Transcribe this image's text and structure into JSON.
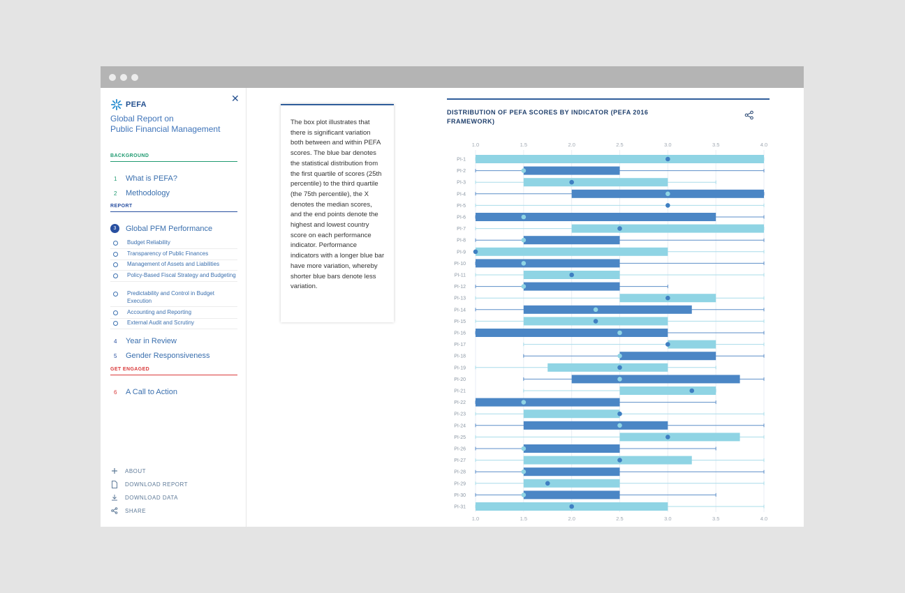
{
  "sidebar": {
    "logo_text": "PEFA",
    "title_line1": "Global Report on",
    "title_line2": "Public Financial Management",
    "background_label": "BACKGROUND",
    "report_label": "REPORT",
    "engaged_label": "GET ENGAGED",
    "nav": [
      {
        "num": "1",
        "label": "What is PEFA?"
      },
      {
        "num": "2",
        "label": "Methodology"
      },
      {
        "num": "3",
        "label": "Global PFM Performance"
      },
      {
        "num": "4",
        "label": "Year in Review"
      },
      {
        "num": "5",
        "label": "Gender Responsiveness"
      },
      {
        "num": "6",
        "label": "A Call to Action"
      }
    ],
    "subitems": [
      "Budget Reliability",
      "Transparency of Public Finances",
      "Management of Assets and Liabilities",
      "Policy-Based Fiscal Strategy and Budgeting",
      "Predictability and Control in Budget Execution",
      "Accounting and Reporting",
      "External Audit and Scrutiny"
    ],
    "footer": [
      "ABOUT",
      "DOWNLOAD REPORT",
      "DOWNLOAD DATA",
      "SHARE"
    ]
  },
  "text_card": "The box plot illustrates that there is significant variation both between and within PEFA scores. The blue bar denotes the statistical distribution from the first quartile of scores (25th percentile) to the third quartile (the 75th percentile), the X denotes the median scores, and the end points denote the highest and lowest country score on each performance indicator. Performance indicators with a longer blue bar have more variation, whereby shorter blue bars denote less variation.",
  "colors": {
    "dark_box": "#4b86c5",
    "light_box": "#8fd4e4",
    "accent": "#2f5d9a"
  },
  "chart_data": {
    "type": "box",
    "title": "DISTRIBUTION OF PEFA SCORES BY INDICATOR (PEFA 2016 FRAMEWORK)",
    "xlim": [
      1.0,
      4.0
    ],
    "xticks": [
      "1.0",
      "1.5",
      "2.0",
      "2.5",
      "3.0",
      "3.5",
      "4.0"
    ],
    "grid": true,
    "indicators": [
      {
        "label": "PI-1",
        "min": 1.0,
        "q1": 1.0,
        "median": 3.0,
        "q3": 4.0,
        "max": 4.0,
        "tone": "light"
      },
      {
        "label": "PI-2",
        "min": 1.0,
        "q1": 1.5,
        "median": 1.5,
        "q3": 2.5,
        "max": 4.0,
        "tone": "dark"
      },
      {
        "label": "PI-3",
        "min": 1.0,
        "q1": 1.5,
        "median": 2.0,
        "q3": 3.0,
        "max": 3.5,
        "tone": "light"
      },
      {
        "label": "PI-4",
        "min": 1.0,
        "q1": 2.0,
        "median": 3.0,
        "q3": 4.0,
        "max": 4.0,
        "tone": "dark"
      },
      {
        "label": "PI-5",
        "min": 1.0,
        "q1": 3.0,
        "median": 3.0,
        "q3": 3.0,
        "max": 4.0,
        "tone": "light"
      },
      {
        "label": "PI-6",
        "min": 1.0,
        "q1": 1.0,
        "median": 1.5,
        "q3": 3.5,
        "max": 4.0,
        "tone": "dark"
      },
      {
        "label": "PI-7",
        "min": 1.0,
        "q1": 2.0,
        "median": 2.5,
        "q3": 4.0,
        "max": 4.0,
        "tone": "light"
      },
      {
        "label": "PI-8",
        "min": 1.0,
        "q1": 1.5,
        "median": 1.5,
        "q3": 2.5,
        "max": 4.0,
        "tone": "dark"
      },
      {
        "label": "PI-9",
        "min": 1.0,
        "q1": 1.0,
        "median": 1.0,
        "q3": 3.0,
        "max": 4.0,
        "tone": "light"
      },
      {
        "label": "PI-10",
        "min": 1.0,
        "q1": 1.0,
        "median": 1.5,
        "q3": 2.5,
        "max": 4.0,
        "tone": "dark"
      },
      {
        "label": "PI-11",
        "min": 1.0,
        "q1": 1.5,
        "median": 2.0,
        "q3": 2.5,
        "max": 4.0,
        "tone": "light"
      },
      {
        "label": "PI-12",
        "min": 1.0,
        "q1": 1.5,
        "median": 1.5,
        "q3": 2.5,
        "max": 3.0,
        "tone": "dark"
      },
      {
        "label": "PI-13",
        "min": 1.0,
        "q1": 2.5,
        "median": 3.0,
        "q3": 3.5,
        "max": 4.0,
        "tone": "light"
      },
      {
        "label": "PI-14",
        "min": 1.0,
        "q1": 1.5,
        "median": 2.25,
        "q3": 3.25,
        "max": 4.0,
        "tone": "dark"
      },
      {
        "label": "PI-15",
        "min": 1.0,
        "q1": 1.5,
        "median": 2.25,
        "q3": 3.0,
        "max": 4.0,
        "tone": "light"
      },
      {
        "label": "PI-16",
        "min": 1.0,
        "q1": 1.0,
        "median": 2.5,
        "q3": 3.0,
        "max": 4.0,
        "tone": "dark"
      },
      {
        "label": "PI-17",
        "min": 1.5,
        "q1": 3.0,
        "median": 3.0,
        "q3": 3.5,
        "max": 4.0,
        "tone": "light"
      },
      {
        "label": "PI-18",
        "min": 1.5,
        "q1": 2.5,
        "median": 2.5,
        "q3": 3.5,
        "max": 4.0,
        "tone": "dark"
      },
      {
        "label": "PI-19",
        "min": 1.0,
        "q1": 1.75,
        "median": 2.5,
        "q3": 3.0,
        "max": 3.5,
        "tone": "light"
      },
      {
        "label": "PI-20",
        "min": 1.5,
        "q1": 2.0,
        "median": 2.5,
        "q3": 3.75,
        "max": 4.0,
        "tone": "dark"
      },
      {
        "label": "PI-21",
        "min": 1.5,
        "q1": 2.5,
        "median": 3.25,
        "q3": 3.5,
        "max": 3.5,
        "tone": "light"
      },
      {
        "label": "PI-22",
        "min": 1.0,
        "q1": 1.0,
        "median": 1.5,
        "q3": 2.5,
        "max": 3.5,
        "tone": "dark"
      },
      {
        "label": "PI-23",
        "min": 1.0,
        "q1": 1.5,
        "median": 2.5,
        "q3": 2.5,
        "max": 4.0,
        "tone": "light"
      },
      {
        "label": "PI-24",
        "min": 1.0,
        "q1": 1.5,
        "median": 2.5,
        "q3": 3.0,
        "max": 4.0,
        "tone": "dark"
      },
      {
        "label": "PI-25",
        "min": 1.0,
        "q1": 2.5,
        "median": 3.0,
        "q3": 3.75,
        "max": 4.0,
        "tone": "light"
      },
      {
        "label": "PI-26",
        "min": 1.0,
        "q1": 1.5,
        "median": 1.5,
        "q3": 2.5,
        "max": 3.5,
        "tone": "dark"
      },
      {
        "label": "PI-27",
        "min": 1.0,
        "q1": 1.5,
        "median": 2.5,
        "q3": 3.25,
        "max": 4.0,
        "tone": "light"
      },
      {
        "label": "PI-28",
        "min": 1.0,
        "q1": 1.5,
        "median": 1.5,
        "q3": 2.5,
        "max": 4.0,
        "tone": "dark"
      },
      {
        "label": "PI-29",
        "min": 1.0,
        "q1": 1.5,
        "median": 1.75,
        "q3": 2.5,
        "max": 4.0,
        "tone": "light"
      },
      {
        "label": "PI-30",
        "min": 1.0,
        "q1": 1.5,
        "median": 1.5,
        "q3": 2.5,
        "max": 3.5,
        "tone": "dark"
      },
      {
        "label": "PI-31",
        "min": 1.0,
        "q1": 1.0,
        "median": 2.0,
        "q3": 3.0,
        "max": 4.0,
        "tone": "light"
      }
    ]
  }
}
